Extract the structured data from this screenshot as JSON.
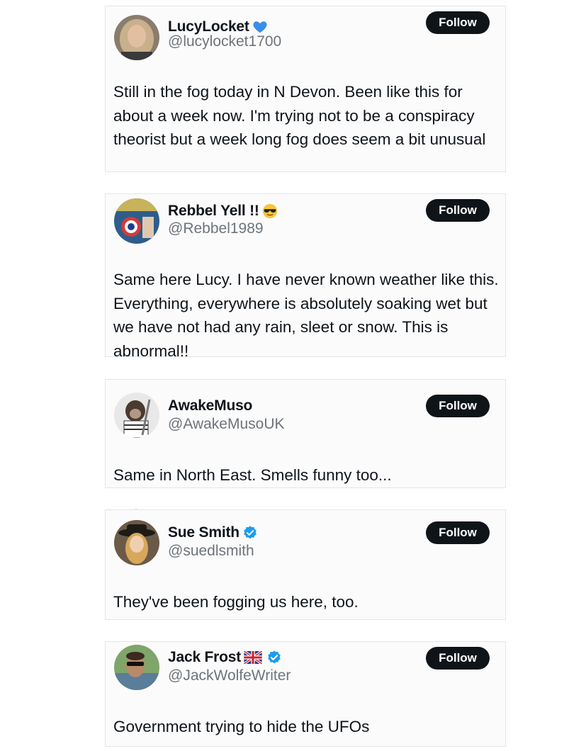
{
  "replies": [
    {
      "display_name": "LucyLocket",
      "handle": "@lucylocket1700",
      "follow_label": "Follow",
      "text": "Still in the fog today in N Devon. Been like this for about a week now. I'm trying not to be a conspiracy theorist but a week long fog does seem a bit unusual",
      "badge": "blue-heart-icon"
    },
    {
      "display_name": "Rebbel Yell !!",
      "handle": "@Rebbel1989",
      "follow_label": "Follow",
      "text": "Same here Lucy. I have never known weather like this. Everything, everywhere is absolutely soaking wet but we have not had any rain, sleet or snow. This is abnormal!!",
      "badge": "sunglasses-emoji-icon"
    },
    {
      "display_name": "AwakeMuso",
      "handle": "@AwakeMusoUK",
      "follow_label": "Follow",
      "text": "Same in North East. Smells funny too...",
      "badge": ""
    },
    {
      "display_name": "Sue Smith",
      "handle": "@suedlsmith",
      "follow_label": "Follow",
      "text": "They've been fogging us here, too.",
      "badge": "verified-badge-icon"
    },
    {
      "display_name": "Jack Frost",
      "handle": "@JackWolfeWriter",
      "follow_label": "Follow",
      "text": "Government trying to hide the UFOs",
      "badge": "uk-flag-icon verified-badge-icon"
    }
  ],
  "colors": {
    "follow_bg": "#0f1419",
    "handle_gray": "#6e7479",
    "verified_blue": "#1d9bf0",
    "heart_blue": "#3b8ee8"
  }
}
